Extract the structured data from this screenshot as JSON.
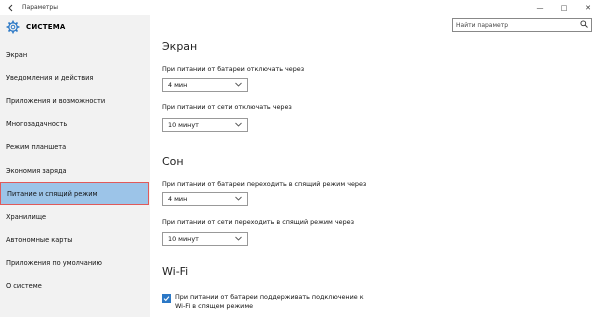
{
  "window": {
    "title": "Параметры",
    "back_icon": "back-arrow-icon",
    "minimize": "—",
    "maximize": "□",
    "close": "✕"
  },
  "sidebar": {
    "header": "СИСТЕМА",
    "items": [
      {
        "label": "Экран"
      },
      {
        "label": "Уведомления и действия"
      },
      {
        "label": "Приложения и возможности"
      },
      {
        "label": "Многозадачность"
      },
      {
        "label": "Режим планшета"
      },
      {
        "label": "Экономия заряда"
      },
      {
        "label": "Питание и спящий режим",
        "active": true
      },
      {
        "label": "Хранилище"
      },
      {
        "label": "Автономные карты"
      },
      {
        "label": "Приложения по умолчанию"
      },
      {
        "label": "О системе"
      }
    ]
  },
  "search": {
    "placeholder": "Найти параметр"
  },
  "screen": {
    "title": "Экран",
    "battery_label": "При питании от батареи отключать через",
    "battery_value": "4 мин",
    "ac_label": "При питании от сети отключать через",
    "ac_value": "10 минут"
  },
  "sleep": {
    "title": "Сон",
    "battery_label": "При питании от батареи переходить в спящий режим через",
    "battery_value": "4 мин",
    "ac_label": "При питании от сети переходить в спящий режим через",
    "ac_value": "10 минут"
  },
  "wifi": {
    "title": "Wi-Fi",
    "checkbox_label": "При питании от батареи поддерживать подключение к Wi-Fi в спящем режиме",
    "checked": true
  },
  "colors": {
    "accent": "#2b78c6",
    "active_nav": "#9cc4e8",
    "highlight_border": "#e05a5a"
  }
}
